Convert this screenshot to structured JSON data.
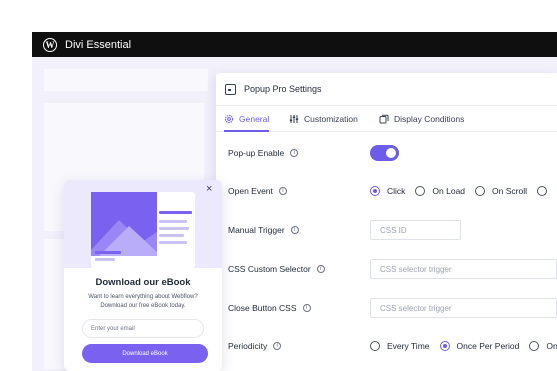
{
  "topbar": {
    "title": "Divi Essential",
    "logo_glyph": "W"
  },
  "panel": {
    "title": "Popup Pro Settings",
    "tabs": [
      {
        "label": "General",
        "icon": "gear-icon",
        "active": true
      },
      {
        "label": "Customization",
        "icon": "sliders-icon",
        "active": false
      },
      {
        "label": "Display Conditions",
        "icon": "copy-icon",
        "active": false
      }
    ],
    "fields": {
      "popup_enable": {
        "label": "Pop-up Enable",
        "value": true
      },
      "open_event": {
        "label": "Open Event",
        "options": [
          "Click",
          "On Load",
          "On Scroll"
        ],
        "selected": "Click"
      },
      "manual_trigger": {
        "label": "Manual Trigger",
        "placeholder": "CSS ID"
      },
      "css_selector": {
        "label": "CSS Custom Selector",
        "placeholder": "CSS selector trigger"
      },
      "close_button_css": {
        "label": "Close Button CSS",
        "placeholder": "CSS selector trigger"
      },
      "periodicity": {
        "label": "Periodicity",
        "options": [
          "Every Time",
          "Once Per Period",
          "On"
        ],
        "selected": "Once Per Period"
      }
    },
    "info_glyph": "i"
  },
  "popup": {
    "close_glyph": "×",
    "title": "Download our eBook",
    "subtitle_line1": "Want to learn everything about Webflow?",
    "subtitle_line2": "Download our free eBook today.",
    "email_placeholder": "Enter your email",
    "button_label": "Download eBook"
  },
  "colors": {
    "accent": "#6c5ce7",
    "topbar": "#0f0f10",
    "canvas": "#f1f0fb"
  }
}
